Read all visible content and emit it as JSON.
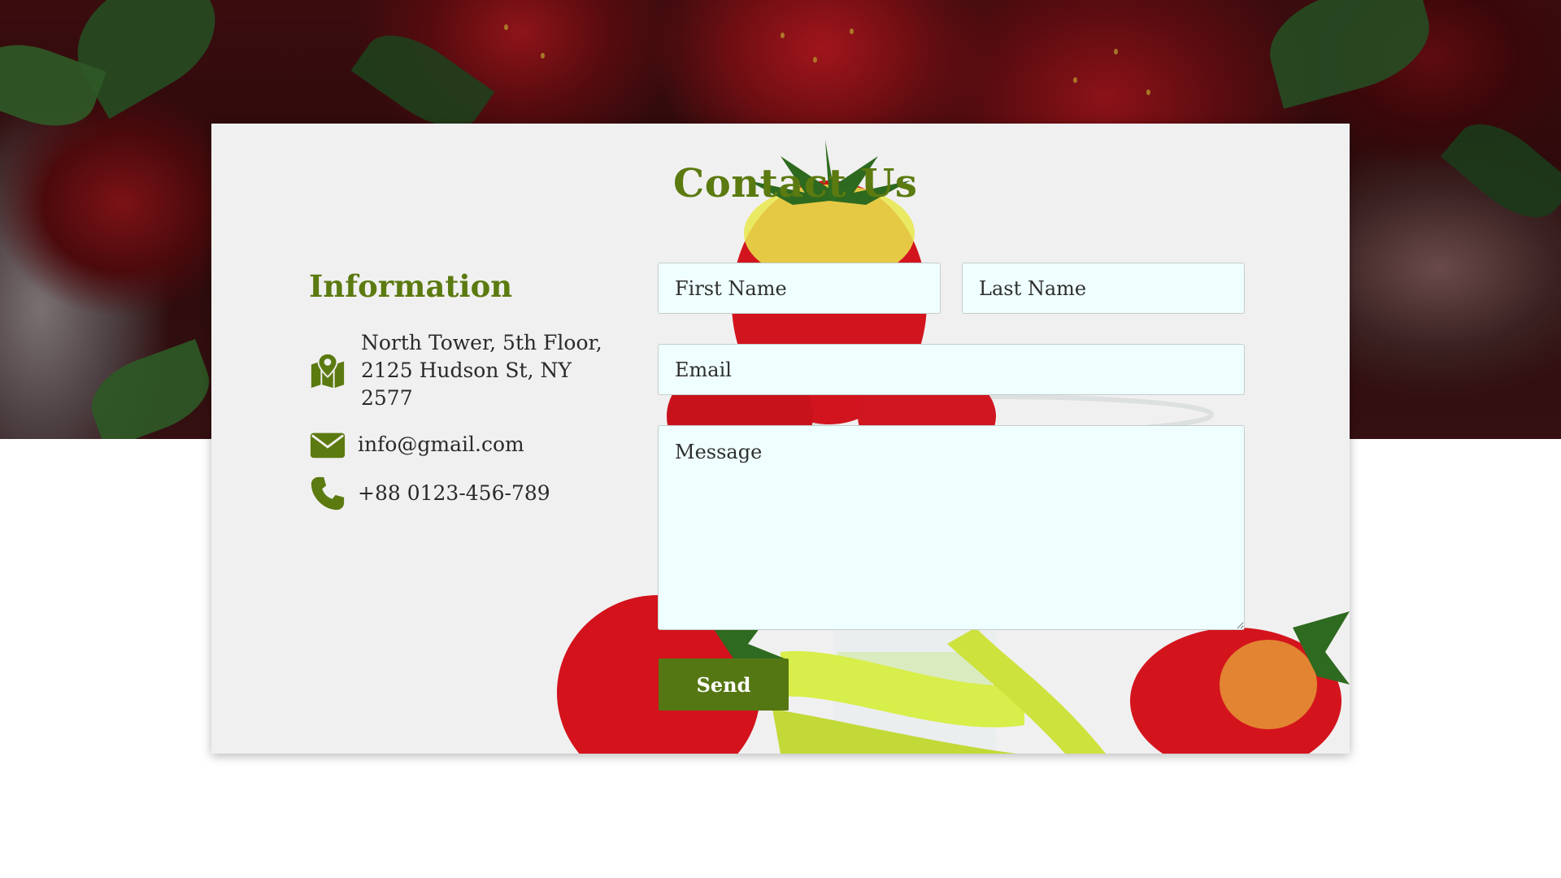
{
  "page": {
    "title": "Contact Us"
  },
  "info": {
    "heading": "Information",
    "address": "North Tower, 5th Floor, 2125 Hudson St, NY 2577",
    "email": "info@gmail.com",
    "phone": "+88 0123-456-789",
    "icons": {
      "address": "map-icon",
      "email": "envelope-icon",
      "phone": "phone-icon"
    }
  },
  "form": {
    "first_name": {
      "placeholder": "First Name",
      "value": ""
    },
    "last_name": {
      "placeholder": "Last Name",
      "value": ""
    },
    "email": {
      "placeholder": "Email",
      "value": ""
    },
    "message": {
      "placeholder": "Message",
      "value": ""
    },
    "send_label": "Send"
  },
  "colors": {
    "accent": "#5b7a10",
    "button": "#557713",
    "field_background": "#effefe",
    "card_background": "#f1f0f0"
  }
}
